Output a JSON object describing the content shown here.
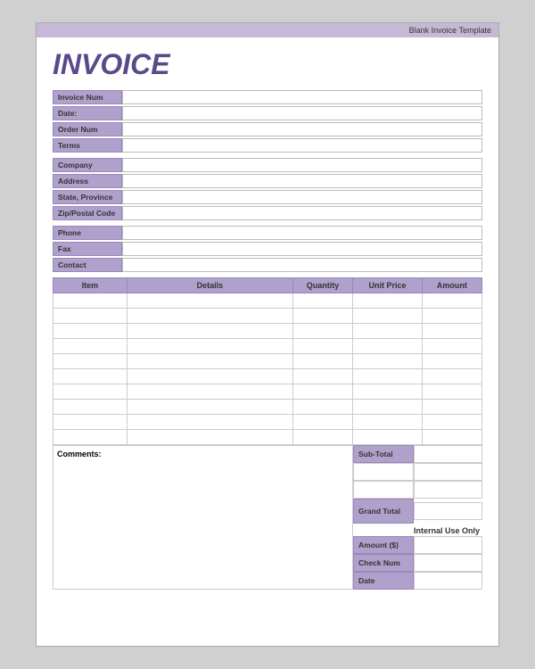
{
  "topbar": {
    "label": "Blank Invoice Template"
  },
  "title": "INVOICE",
  "info_fields": {
    "invoice_num": {
      "label": "Invoice Num",
      "value": ""
    },
    "date": {
      "label": "Date:",
      "value": ""
    },
    "order_num": {
      "label": "Order Num",
      "value": ""
    },
    "terms": {
      "label": "Terms",
      "value": ""
    }
  },
  "company_fields": {
    "company": {
      "label": "Company",
      "value": ""
    },
    "address": {
      "label": "Address",
      "value": ""
    },
    "state_province": {
      "label": "State, Province",
      "value": ""
    },
    "zip_postal": {
      "label": "Zip/Postal Code",
      "value": ""
    }
  },
  "contact_fields": {
    "phone": {
      "label": "Phone",
      "value": ""
    },
    "fax": {
      "label": "Fax",
      "value": ""
    },
    "contact": {
      "label": "Contact",
      "value": ""
    }
  },
  "table": {
    "headers": {
      "item": "Item",
      "details": "Details",
      "quantity": "Quantity",
      "unit_price": "Unit Price",
      "amount": "Amount"
    },
    "rows": 10
  },
  "comments_label": "Comments:",
  "totals": {
    "sub_total": "Sub-Total",
    "grand_total": "Grand Total",
    "internal_use": "Internal Use Only",
    "amount_s": "Amount ($)",
    "check_num": "Check Num",
    "date": "Date"
  }
}
